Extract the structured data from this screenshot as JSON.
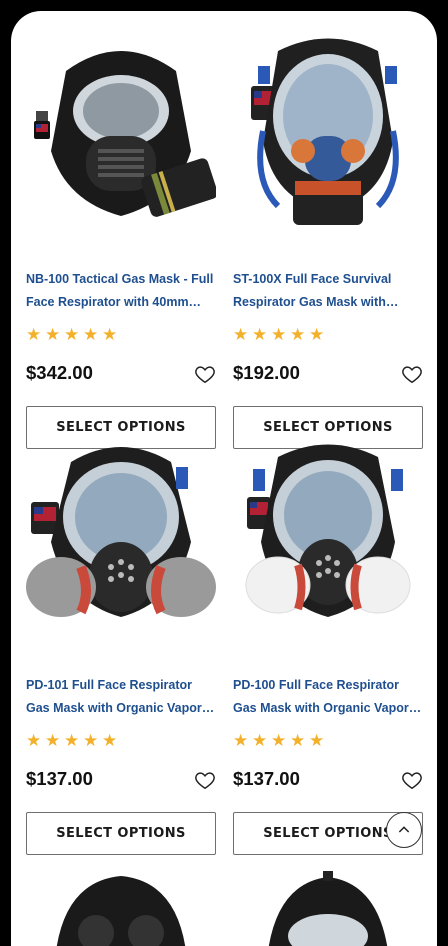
{
  "products": [
    {
      "title_line1": "NB-100 Tactical Gas Mask - Full",
      "title_line2": "Face Respirator with 40mm…",
      "rating": 5,
      "price": "$342.00",
      "button": "SELECT OPTIONS",
      "image_icon": "gas-mask-black-tactical-icon"
    },
    {
      "title_line1": "ST-100X Full Face Survival",
      "title_line2": "Respirator Gas Mask with…",
      "rating": 5,
      "price": "$192.00",
      "button": "SELECT OPTIONS",
      "image_icon": "gas-mask-blue-orange-icon"
    },
    {
      "title_line1": "PD-101 Full Face Respirator",
      "title_line2": "Gas Mask with Organic Vapor…",
      "rating": 5,
      "price": "$137.00",
      "button": "SELECT OPTIONS",
      "image_icon": "gas-mask-red-filters-icon"
    },
    {
      "title_line1": "PD-100 Full Face Respirator",
      "title_line2": "Gas Mask with Organic Vapor…",
      "rating": 5,
      "price": "$137.00",
      "button": "SELECT OPTIONS",
      "image_icon": "gas-mask-white-filters-icon"
    }
  ],
  "colors": {
    "title": "#1f4f8f",
    "star": "#f3b12b",
    "price": "#111111"
  },
  "icons": {
    "wishlist": "heart-outline-icon",
    "scroll_top": "chevron-up-icon"
  }
}
